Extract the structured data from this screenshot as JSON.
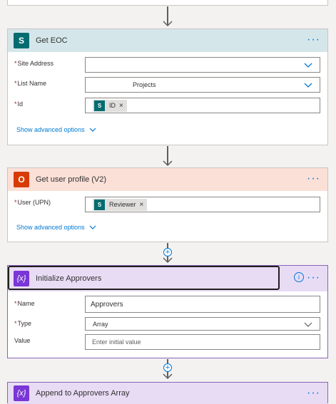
{
  "cards": {
    "get_eoc": {
      "title": "Get EOC",
      "fields": {
        "site_address": {
          "label": "Site Address",
          "value": ""
        },
        "list_name": {
          "label": "List Name",
          "value": "Projects"
        },
        "id": {
          "label": "Id",
          "token": "ID"
        }
      },
      "advanced": "Show advanced options"
    },
    "get_user_profile": {
      "title": "Get user profile (V2)",
      "fields": {
        "user_upn": {
          "label": "User (UPN)",
          "token": "Reviewer"
        }
      },
      "advanced": "Show advanced options"
    },
    "initialize_approvers": {
      "title": "Initialize Approvers",
      "fields": {
        "name": {
          "label": "Name",
          "value": "Approvers"
        },
        "type": {
          "label": "Type",
          "value": "Array"
        },
        "value": {
          "label": "Value",
          "placeholder": "Enter initial value"
        }
      }
    },
    "append_approvers": {
      "title": "Append to Approvers Array"
    }
  },
  "colors": {
    "sharepoint": "#036c70",
    "office": "#d83b01",
    "variable": "#6b2fbb",
    "accent": "#0078d4"
  },
  "icons": {
    "more": "more-horizontal-icon",
    "info": "info-icon",
    "chevron": "chevron-down-icon"
  }
}
